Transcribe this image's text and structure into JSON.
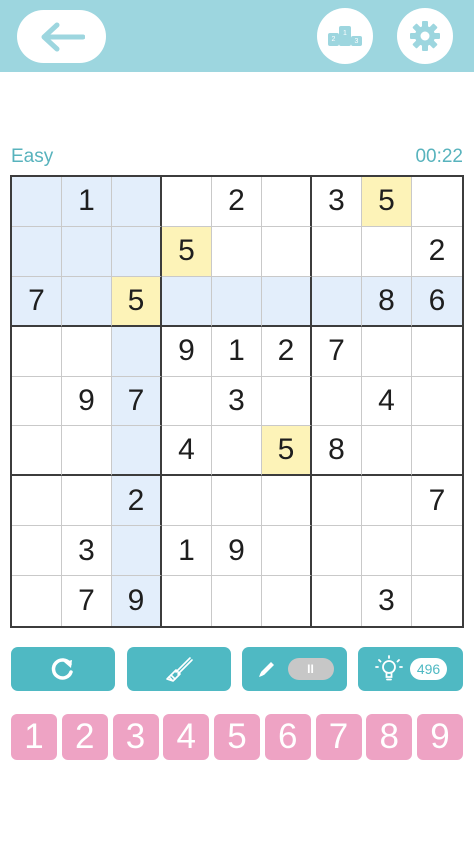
{
  "header": {
    "back": "back-arrow-icon",
    "ranking": "leaderboard-icon",
    "settings": "gear-icon"
  },
  "status": {
    "difficulty": "Easy",
    "timer": "00:22"
  },
  "board": {
    "rows": [
      [
        "",
        "1",
        "",
        "",
        "2",
        "",
        "3",
        "5",
        ""
      ],
      [
        "",
        "",
        "",
        "5",
        "",
        "",
        "",
        "",
        "2"
      ],
      [
        "7",
        "",
        "5",
        "",
        "",
        "",
        "",
        "8",
        "6"
      ],
      [
        "",
        "",
        "",
        "9",
        "1",
        "2",
        "7",
        "",
        ""
      ],
      [
        "",
        "9",
        "7",
        "",
        "3",
        "",
        "",
        "4",
        ""
      ],
      [
        "",
        "",
        "",
        "4",
        "",
        "5",
        "8",
        "",
        ""
      ],
      [
        "",
        "",
        "2",
        "",
        "",
        "",
        "",
        "",
        "7"
      ],
      [
        "",
        "3",
        "",
        "1",
        "9",
        "",
        "",
        "",
        ""
      ],
      [
        "",
        "7",
        "9",
        "",
        "",
        "",
        "",
        "3",
        ""
      ]
    ],
    "selected_value": "5"
  },
  "tools": {
    "undo": "refresh-icon",
    "erase": "eraser-icon",
    "pencil": "pencil-icon",
    "pencil_toggle": "II",
    "hint": "lightbulb-icon",
    "hint_count": "496"
  },
  "numpad": [
    "1",
    "2",
    "3",
    "4",
    "5",
    "6",
    "7",
    "8",
    "9"
  ],
  "colors": {
    "accent": "#4fb9c3",
    "topbar": "#9dd6df",
    "highlight": "#e3eefb",
    "match": "#fdf3b8",
    "numpad": "#eea3c4"
  }
}
